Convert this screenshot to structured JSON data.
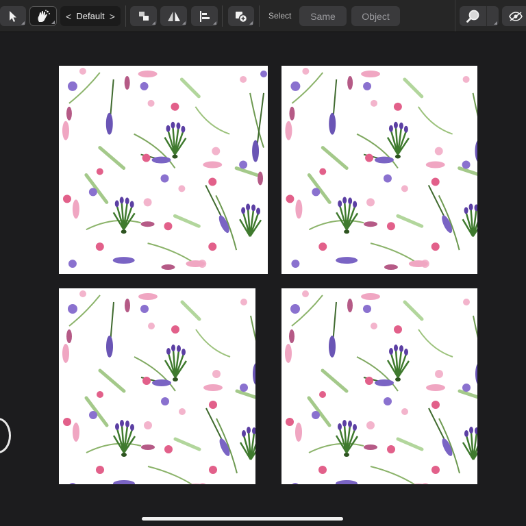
{
  "toolbar": {
    "select_tool_icon": "arrow-pointer-icon",
    "gesture_tool_icon": "hand-sparkle-icon",
    "preset_label": "Default",
    "preset_prev_glyph": "<",
    "preset_next_glyph": ">",
    "arrange_icon": "arrange-stack-icon",
    "flip_icon": "flip-horizontal-icon",
    "align_icon": "align-left-icon",
    "boolean_add_icon": "boolean-add-icon",
    "select_label": "Select",
    "same_label": "Same",
    "object_label": "Object",
    "zoom_icon": "magnifier-icon",
    "view_icon": "eye-icon"
  },
  "canvas": {
    "tiles": [
      "top-left",
      "top-right",
      "bottom-left",
      "bottom-right"
    ],
    "pattern": "watercolor-lavender-floral",
    "colors": {
      "background": "#ffffff",
      "lavender": "#6a55b5",
      "pink": "#e2608a",
      "light_pink": "#f3b4cc",
      "leaf": "#7fa860",
      "dark_leaf": "#3f6a2e"
    }
  },
  "theme": {
    "app_bg": "#1c1c1e",
    "toolbar_bg": "#262626",
    "button_bg": "#3a3a3c"
  }
}
